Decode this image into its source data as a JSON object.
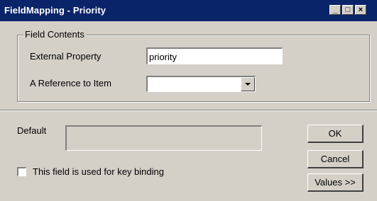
{
  "window": {
    "title": "FieldMapping - Priority",
    "minimize_glyph": "_",
    "maximize_glyph": "□",
    "close_glyph": "×"
  },
  "field_contents": {
    "legend": "Field Contents",
    "external_property_label": "External Property",
    "external_property_value": "priority",
    "reference_label": "A Reference to Item",
    "reference_value": ""
  },
  "default": {
    "label": "Default",
    "value": ""
  },
  "key_binding": {
    "label": "This field is used for key binding",
    "checked": false
  },
  "buttons": {
    "ok": "OK",
    "cancel": "Cancel",
    "values": "Values >>"
  }
}
